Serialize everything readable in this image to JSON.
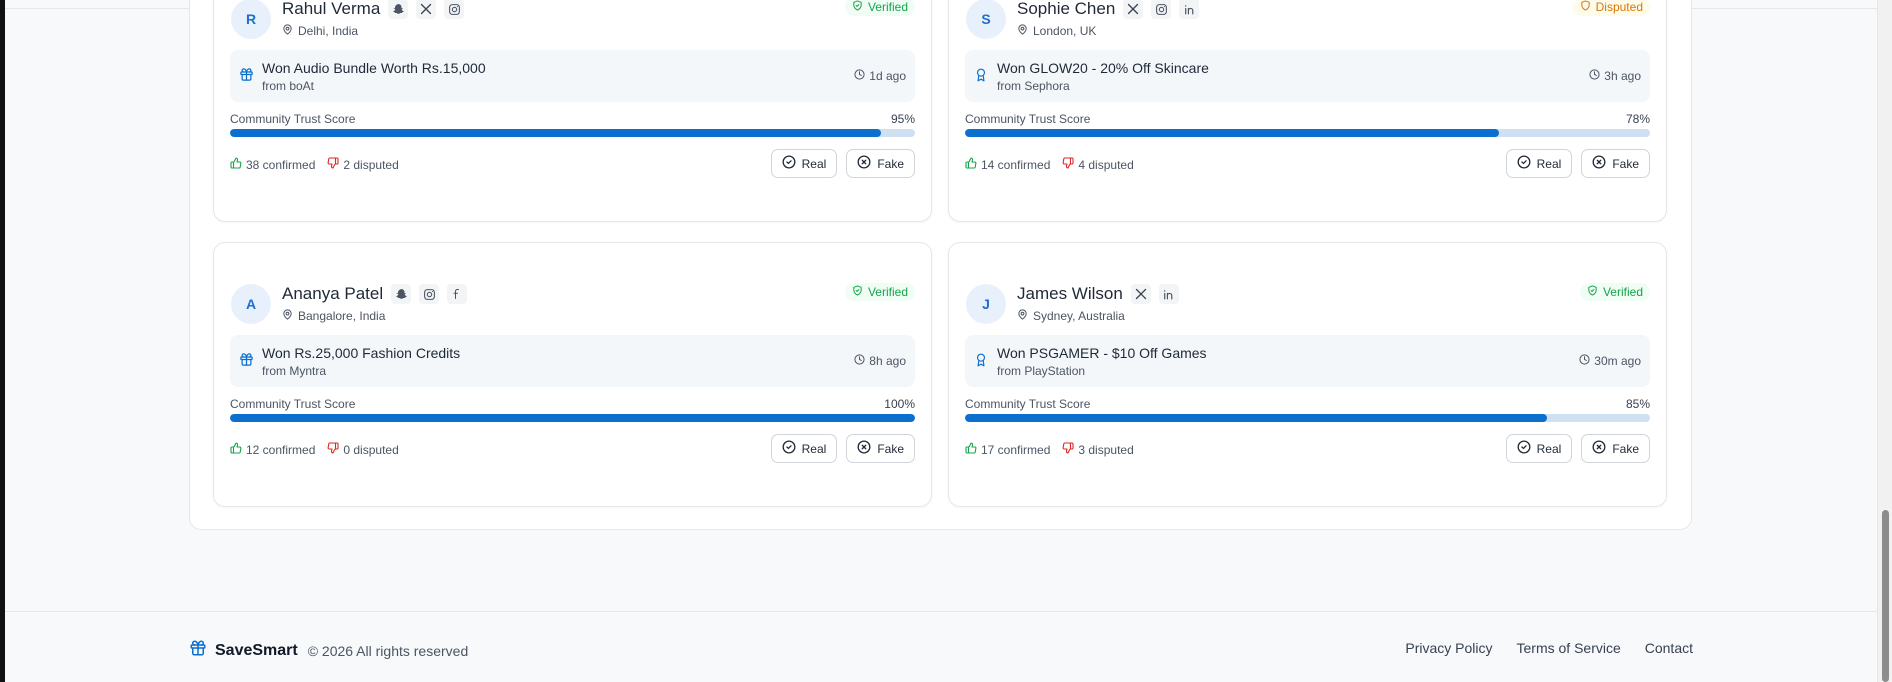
{
  "cards": [
    {
      "initial": "R",
      "name": "Rahul Verma",
      "location": "Delhi, India",
      "socials": [
        "snapchat-icon",
        "x-icon",
        "instagram-icon"
      ],
      "status": "Verified",
      "status_type": "verified",
      "prize_icon": "gift-icon",
      "prize": "Won Audio Bundle Worth Rs.15,000",
      "from": "from boAt",
      "time": "1d ago",
      "trust_label": "Community Trust Score",
      "trust": "95%",
      "trust_fraction": 0.95,
      "confirmed": "38 confirmed",
      "disputed": "2 disputed",
      "real_label": "Real",
      "fake_label": "Fake"
    },
    {
      "initial": "S",
      "name": "Sophie Chen",
      "location": "London, UK",
      "socials": [
        "x-icon",
        "instagram-icon",
        "linkedin-icon"
      ],
      "status": "Disputed",
      "status_type": "disputed",
      "prize_icon": "award-icon",
      "prize": "Won GLOW20 - 20% Off Skincare",
      "from": "from Sephora",
      "time": "3h ago",
      "trust_label": "Community Trust Score",
      "trust": "78%",
      "trust_fraction": 0.78,
      "confirmed": "14 confirmed",
      "disputed": "4 disputed",
      "real_label": "Real",
      "fake_label": "Fake"
    },
    {
      "initial": "A",
      "name": "Ananya Patel",
      "location": "Bangalore, India",
      "socials": [
        "snapchat-icon",
        "instagram-icon",
        "facebook-icon"
      ],
      "status": "Verified",
      "status_type": "verified",
      "prize_icon": "gift-icon",
      "prize": "Won Rs.25,000 Fashion Credits",
      "from": "from Myntra",
      "time": "8h ago",
      "trust_label": "Community Trust Score",
      "trust": "100%",
      "trust_fraction": 1.0,
      "confirmed": "12 confirmed",
      "disputed": "0 disputed",
      "real_label": "Real",
      "fake_label": "Fake"
    },
    {
      "initial": "J",
      "name": "James Wilson",
      "location": "Sydney, Australia",
      "socials": [
        "x-icon",
        "linkedin-icon"
      ],
      "status": "Verified",
      "status_type": "verified",
      "prize_icon": "award-icon",
      "prize": "Won PSGAMER - $10 Off Games",
      "from": "from PlayStation",
      "time": "30m ago",
      "trust_label": "Community Trust Score",
      "trust": "85%",
      "trust_fraction": 0.85,
      "confirmed": "17 confirmed",
      "disputed": "3 disputed",
      "real_label": "Real",
      "fake_label": "Fake"
    }
  ],
  "footer": {
    "brand": "SaveSmart",
    "copyright": "© 2026 All rights reserved",
    "links": [
      "Privacy Policy",
      "Terms of Service",
      "Contact"
    ]
  },
  "colors": {
    "accent": "#0b6fd0",
    "verified": "#16a34a",
    "disputed": "#d97706",
    "confirm": "#16a34a",
    "dispute": "#dc2626"
  }
}
